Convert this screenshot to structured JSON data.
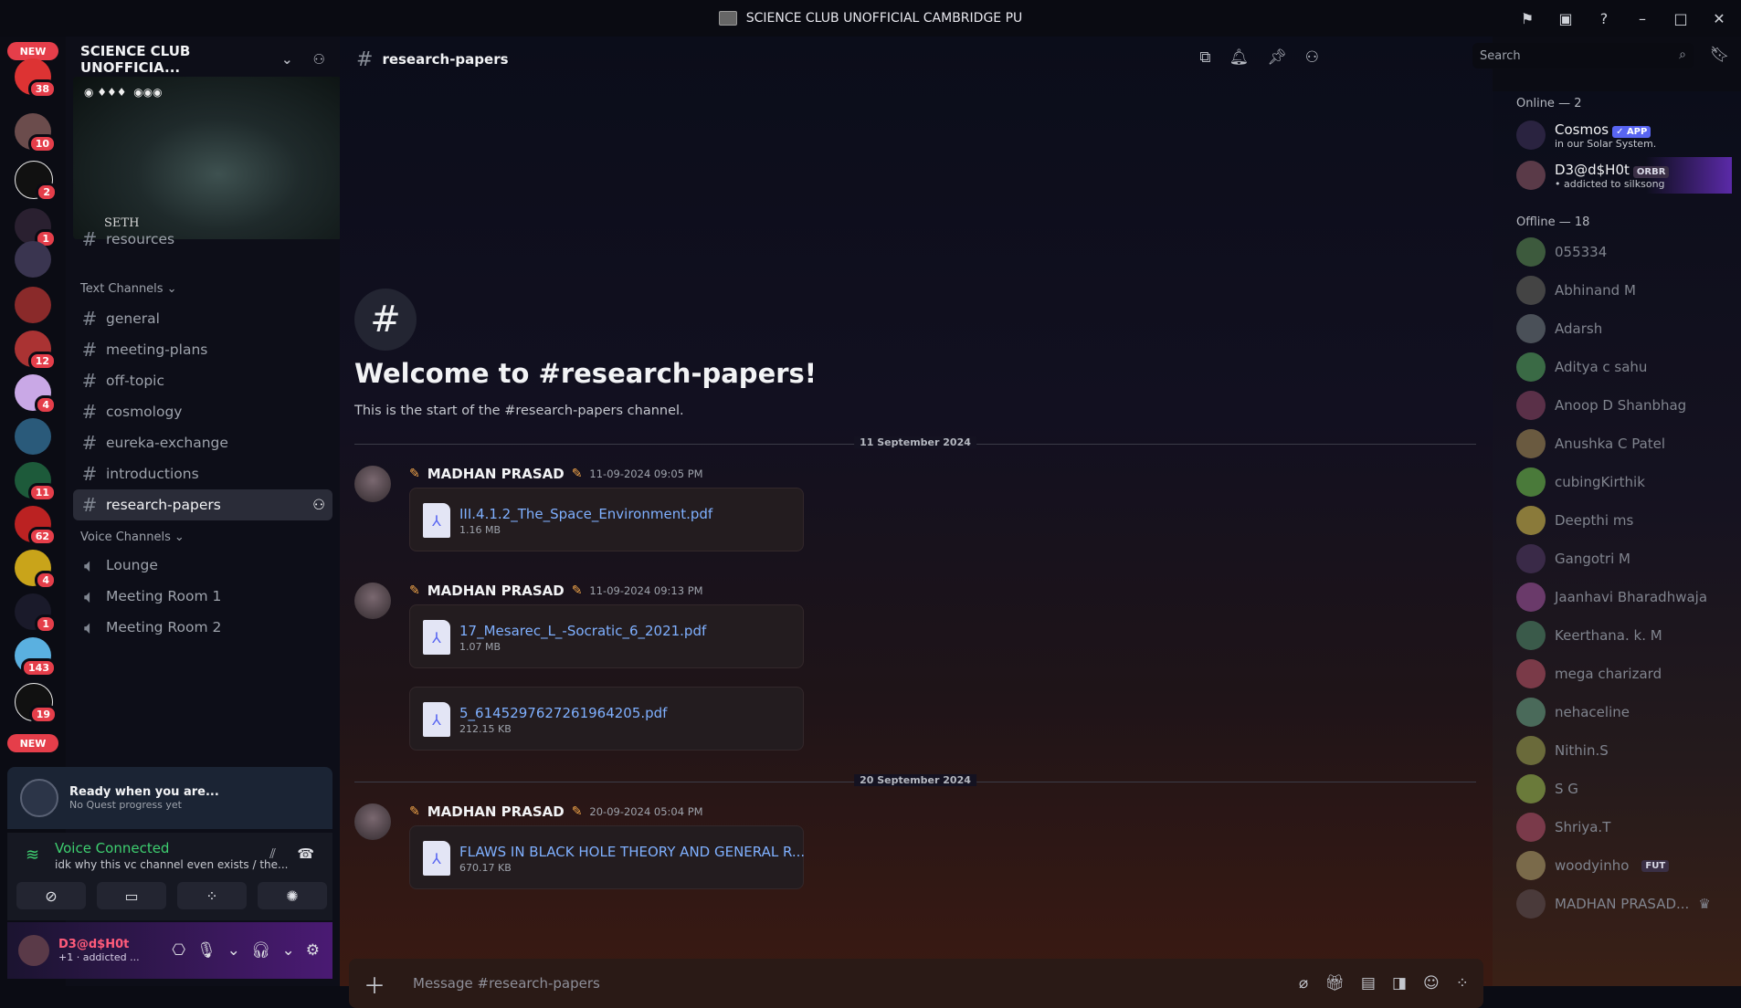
{
  "window": {
    "title": "SCIENCE CLUB UNOFFICIAL CAMBRIDGE PU"
  },
  "rail": {
    "new_top": "NEW",
    "new_bottom": "NEW",
    "badges": [
      "38",
      "10",
      "2",
      "1",
      "12",
      "4",
      "11",
      "62",
      "4",
      "1",
      "143",
      "19"
    ]
  },
  "server": {
    "name": "SCIENCE CLUB UNOFFICIA...",
    "banner_label": "SETH",
    "partial_channel": "resources",
    "text_category": "Text Channels",
    "text_channels": [
      "general",
      "meeting-plans",
      "off-topic",
      "cosmology",
      "eureka-exchange",
      "introductions",
      "research-papers"
    ],
    "voice_category": "Voice Channels",
    "voice_channels": [
      "Lounge",
      "Meeting Room 1",
      "Meeting Room 2"
    ]
  },
  "quest": {
    "title": "Ready when you are...",
    "subtitle": "No Quest progress yet"
  },
  "voice": {
    "status": "Voice Connected",
    "subtitle": "idk why this vc channel even exists / the..."
  },
  "user": {
    "name": "D3@d$H0t",
    "status": "+1 · addicted ..."
  },
  "header": {
    "channel": "research-papers",
    "search_placeholder": "Search"
  },
  "welcome": {
    "title": "Welcome to #research-papers!",
    "subtitle": "This is the start of the #research-papers channel."
  },
  "dividers": [
    "11 September 2024",
    "20 September 2024"
  ],
  "messages": [
    {
      "author": "MADHAN PRASAD",
      "time": "11-09-2024 09:05 PM",
      "files": [
        {
          "name": "III.4.1.2_The_Space_Environment.pdf",
          "size": "1.16 MB"
        }
      ]
    },
    {
      "author": "MADHAN PRASAD",
      "time": "11-09-2024 09:13 PM",
      "files": [
        {
          "name": "17_Mesarec_L_-Socratic_6_2021.pdf",
          "size": "1.07 MB"
        },
        {
          "name": "5_6145297627261964205.pdf",
          "size": "212.15 KB"
        }
      ]
    },
    {
      "author": "MADHAN PRASAD",
      "time": "20-09-2024 05:04 PM",
      "files": [
        {
          "name": "FLAWS IN BLACK HOLE THEORY AND GENERAL R...",
          "size": "670.17 KB"
        }
      ]
    }
  ],
  "composer": {
    "placeholder": "Message #research-papers"
  },
  "members": {
    "online_header": "Online — 2",
    "online": [
      {
        "name": "Cosmos",
        "tag": "✓ APP",
        "status": "in our Solar System."
      },
      {
        "name": "D3@d$H0t",
        "tag": "ORBR",
        "status": "• addicted to silksong"
      }
    ],
    "offline_header": "Offline — 18",
    "offline": [
      "055334",
      "Abhinand M",
      "Adarsh",
      "Aditya c sahu",
      "Anoop D Shanbhag",
      "Anushka C Patel",
      "cubingKirthik",
      "Deepthi ms",
      "Gangotri M",
      "Jaanhavi Bharadhwaja",
      "Keerthana. k. M",
      "mega charizard",
      "nehaceline",
      "Nithin.S",
      "S G",
      "Shriya.T",
      "woodyinho",
      "MADHAN PRASAD..."
    ],
    "offline_tag": "FUT"
  },
  "colors": {
    "accent": "#5865f2",
    "voice_green": "#3ecf70",
    "badge_red": "#e53e4a",
    "link": "#7fb0ff"
  }
}
